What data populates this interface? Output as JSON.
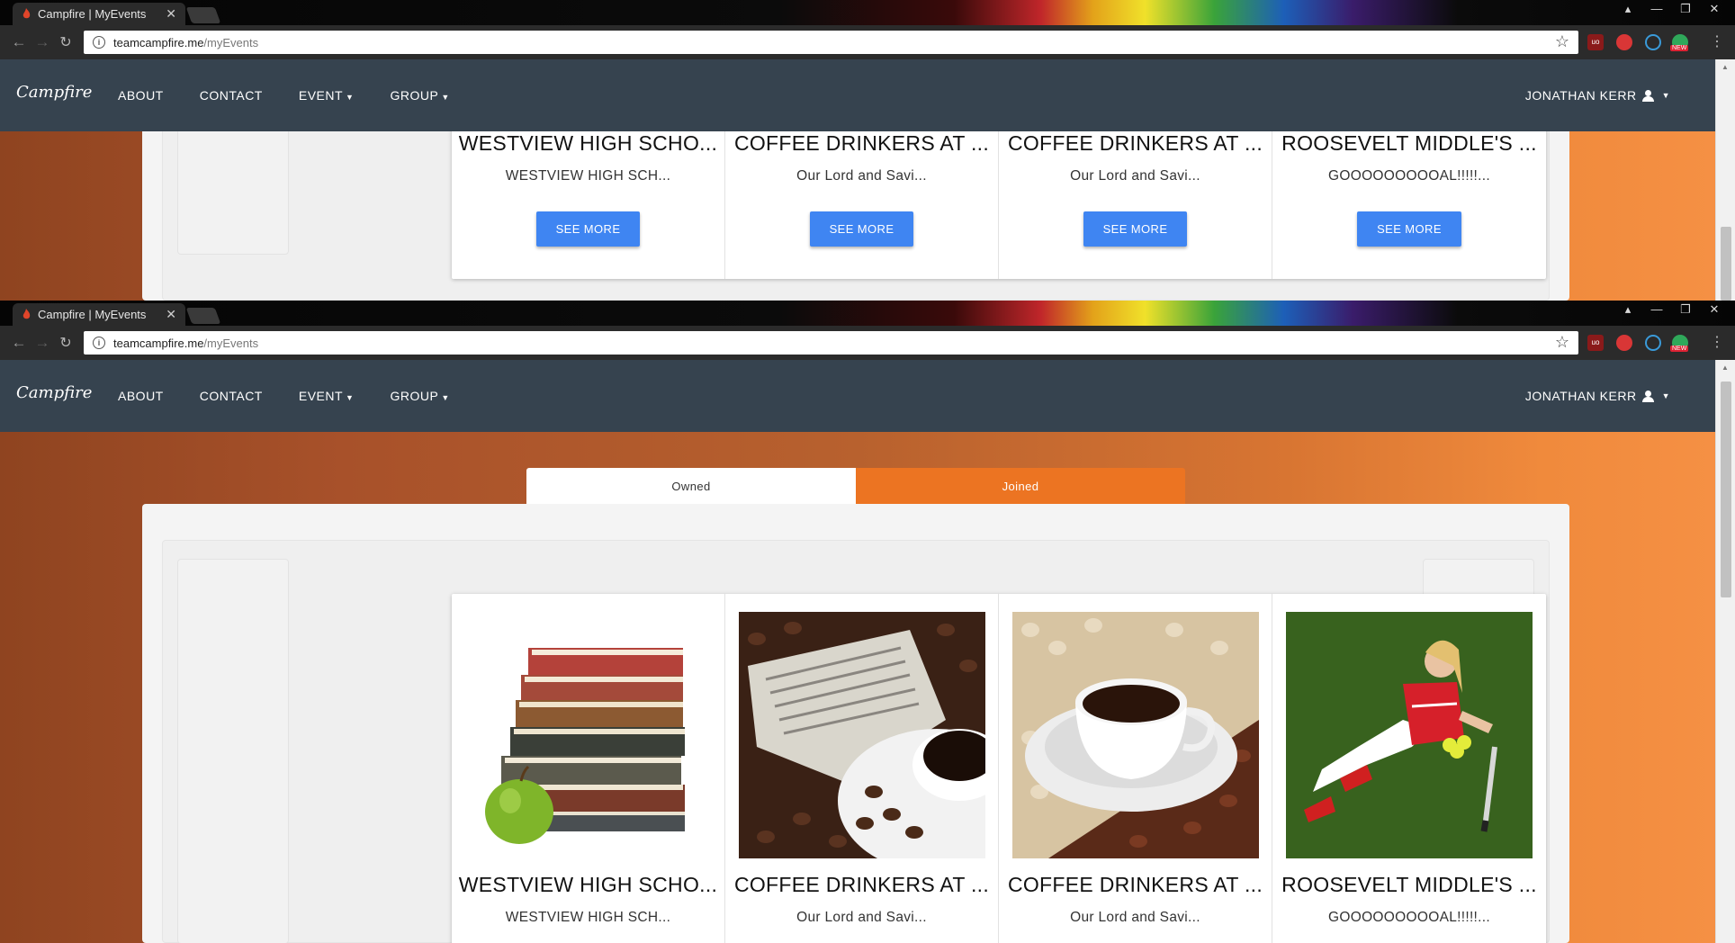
{
  "browser": {
    "tab_title": "Campfire | MyEvents",
    "tab_close": "✕",
    "url_host": "teamcampfire.me",
    "url_path": "/myEvents",
    "window_controls": [
      "▴",
      "—",
      "❐",
      "✕"
    ],
    "extensions": [
      "ublock",
      "red-ext",
      "blue-ext",
      "new-ext"
    ],
    "ext_new_badge": "NEW"
  },
  "nav": {
    "brand": "Campfire",
    "links": [
      "ABOUT",
      "CONTACT",
      "EVENT",
      "GROUP"
    ],
    "user": "JONATHAN KERR"
  },
  "toggle": {
    "owned": "Owned",
    "joined": "Joined"
  },
  "events": [
    {
      "title": "WESTVIEW HIGH SCHO...",
      "desc": "WESTVIEW HIGH SCH...",
      "button": "SEE MORE",
      "image": "books-apple"
    },
    {
      "title": "COFFEE DRINKERS AT ...",
      "desc": "Our Lord and Savi...",
      "button": "SEE MORE",
      "image": "coffee-newspaper"
    },
    {
      "title": "COFFEE DRINKERS AT ...",
      "desc": "Our Lord and Savi...",
      "button": "SEE MORE",
      "image": "coffee-beans-cup"
    },
    {
      "title": "ROOSEVELT MIDDLE'S ...",
      "desc": "GOOOOOOOOOAL!!!!!...",
      "button": "SEE MORE",
      "image": "softball-player"
    }
  ],
  "colors": {
    "navbar": "#36434f",
    "joined": "#ec7422",
    "see_more": "#3f85f2"
  }
}
